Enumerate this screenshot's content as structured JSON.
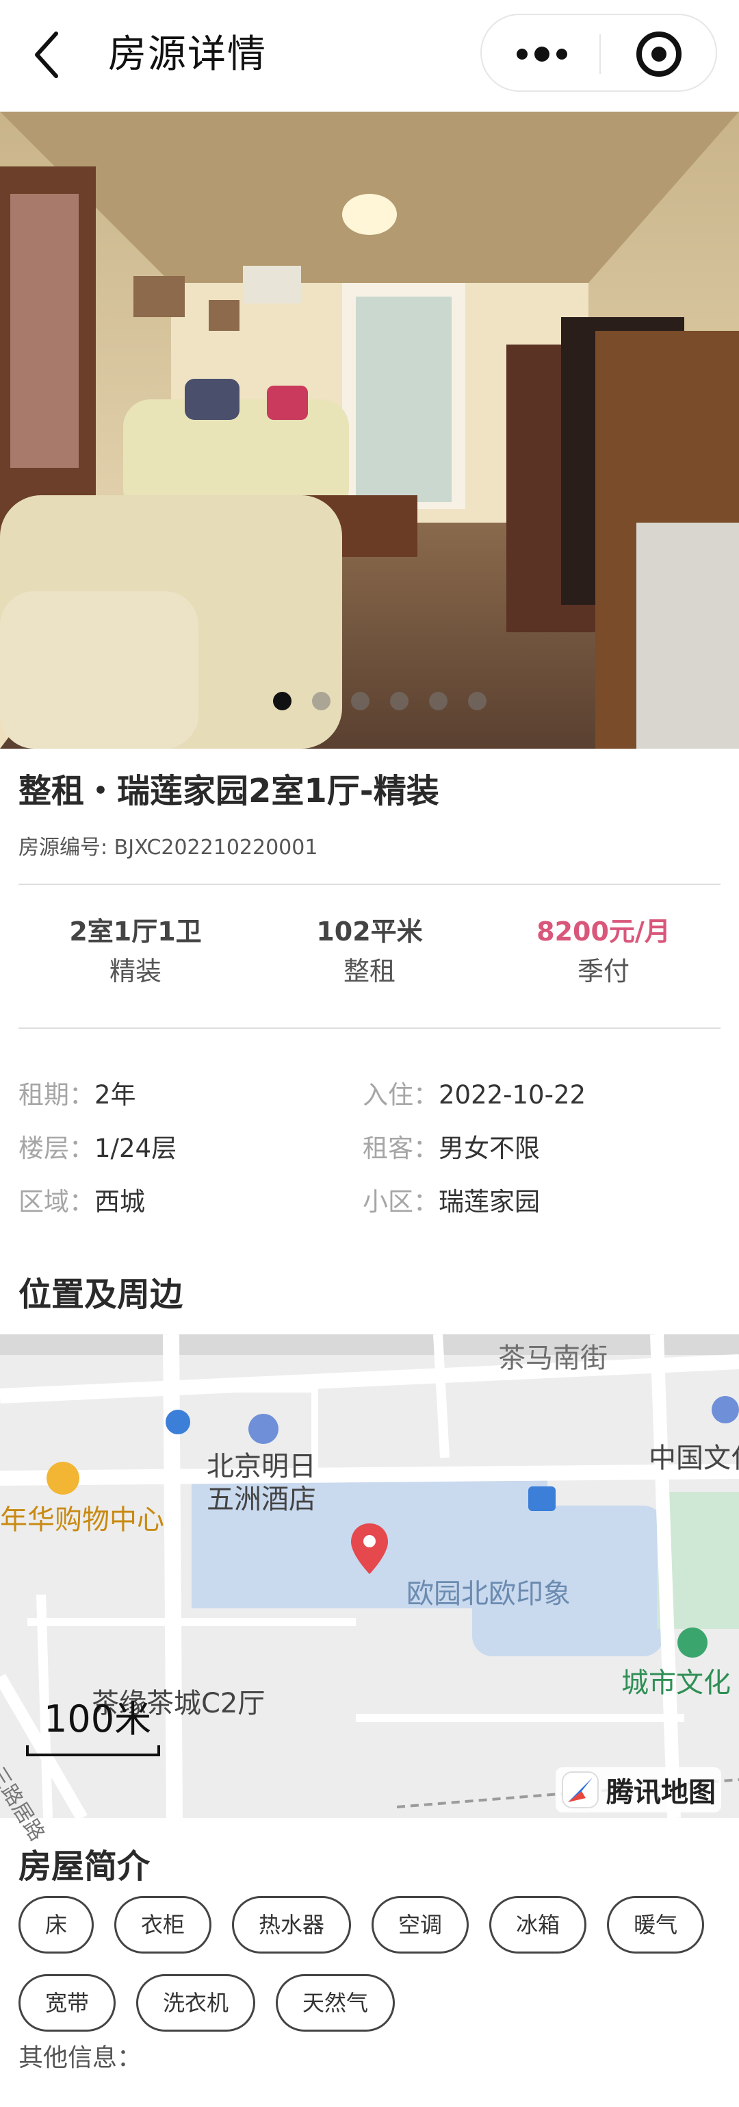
{
  "header": {
    "title": "房源详情"
  },
  "gallery": {
    "count": 6,
    "active_index": 0
  },
  "house": {
    "title": "整租・瑞莲家园2室1厅-精装",
    "code": "房源编号: BJXC202210220001",
    "stats": [
      {
        "value": "2室1厅1卫",
        "sub": "精装"
      },
      {
        "value": "102平米",
        "sub": "整租"
      },
      {
        "value": "8200元/月",
        "sub": "季付"
      }
    ],
    "info": [
      {
        "key": "租期：",
        "value": "2年"
      },
      {
        "key": "入住：",
        "value": "2022-10-22"
      },
      {
        "key": "楼层：",
        "value": "1/24层"
      },
      {
        "key": "租客：",
        "value": "男女不限"
      },
      {
        "key": "区域：",
        "value": "西城"
      },
      {
        "key": "小区：",
        "value": "瑞莲家园"
      }
    ]
  },
  "location": {
    "title": "位置及周边",
    "labels": {
      "street": "茶马南街",
      "hotel_line1": "北京明日",
      "hotel_line2": "五洲酒店",
      "mall": "年华购物中心",
      "culture": "中国文化",
      "community": "欧园北欧印象",
      "tea_city": "茶缘茶城C2厅",
      "city_culture": "城市文化",
      "road": "三路居路"
    },
    "scale": "100米",
    "provider": "腾讯地图"
  },
  "intro": {
    "title": "房屋简介",
    "tags": [
      "床",
      "衣柜",
      "热水器",
      "空调",
      "冰箱",
      "暖气",
      "宽带",
      "洗衣机",
      "天然气"
    ],
    "other_label": "其他信息："
  },
  "colors": {
    "price": "#d9577a",
    "map_water": "#c9d9ee",
    "map_green": "#cfe8d5"
  }
}
